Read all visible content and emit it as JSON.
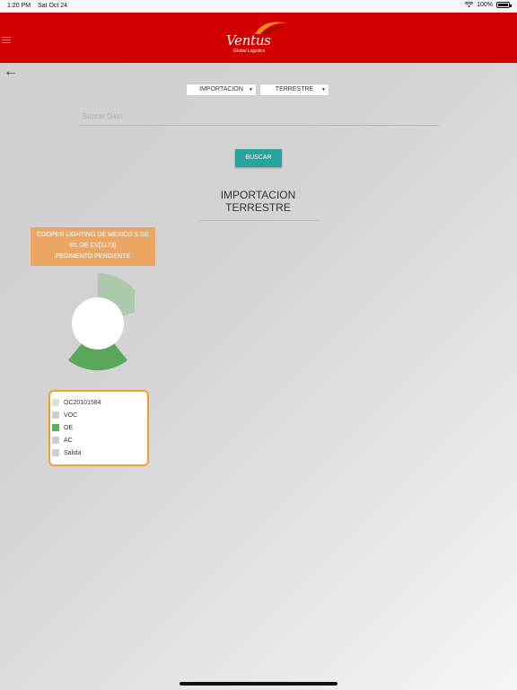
{
  "status_bar": {
    "time": "1:20 PM",
    "date": "Sat Oct 24",
    "battery": "100%"
  },
  "header": {
    "brand": "Ventus",
    "tagline": "Global Logistics",
    "background": "#d30000"
  },
  "filters": {
    "type": "IMPORTACION",
    "mode": "TERRESTRE"
  },
  "search": {
    "placeholder": "Buscar Dato",
    "button_label": "BUSCAR"
  },
  "title": {
    "line1": "IMPORTACION",
    "line2": "TERRESTRE"
  },
  "client_card": {
    "line1": "COOPER LIGHTING DE MEXICO S DE",
    "line2": "RL DE CV[1173]",
    "line3": "PEDIMENTO PENDIENTE",
    "color": "#eca663"
  },
  "legend": {
    "items": [
      {
        "label": "OC20101584",
        "color": "#d6e8c8"
      },
      {
        "label": "VOC",
        "color": "#cfcfcf"
      },
      {
        "label": "OE",
        "color": "#5cae5c"
      },
      {
        "label": "AC",
        "color": "#cfcfcf"
      },
      {
        "label": "Salida",
        "color": "#cfcfcf"
      }
    ]
  }
}
